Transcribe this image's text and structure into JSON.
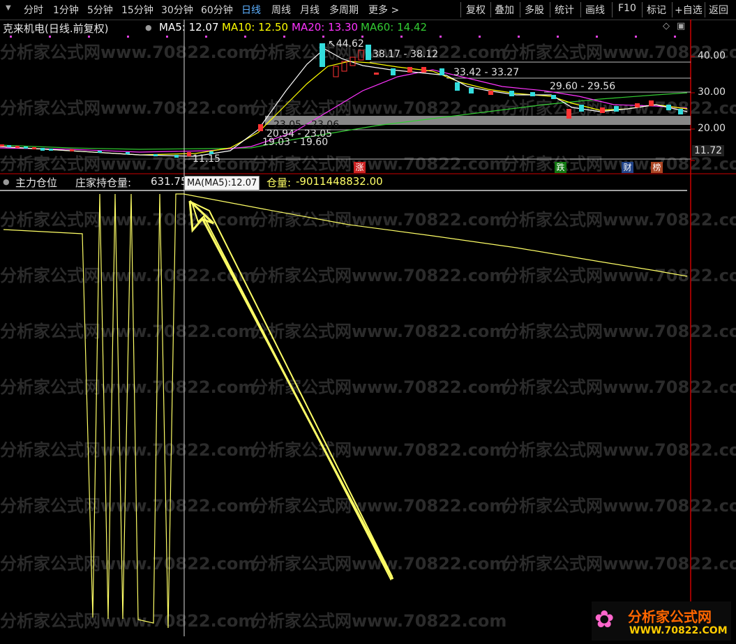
{
  "toolbar": {
    "periods": [
      "分时",
      "1分钟",
      "5分钟",
      "15分钟",
      "30分钟",
      "60分钟",
      "日线",
      "周线",
      "月线",
      "多周期",
      "更多 >"
    ],
    "active_period": "日线",
    "tools": [
      "复权",
      "叠加",
      "多股",
      "统计",
      "画线",
      "F10",
      "标记",
      "+自选",
      "返回"
    ]
  },
  "chart_title": {
    "stock_name": "克来机电(日线.前复权)",
    "ma5": "MA5: 12.07",
    "ma10": "MA10: 12.50",
    "ma20": "MA20: 13.30",
    "ma60": "MA60: 14.42"
  },
  "colors": {
    "ma5": "#ffffff",
    "ma10": "#ffff00",
    "ma20": "#ff33ff",
    "ma60": "#33cc33",
    "up": "#ff3333",
    "down": "#33dddd",
    "indicator": "#ffff66",
    "axis": "#cc0000"
  },
  "price_axis": {
    "labels": [
      "40.00",
      "30.00",
      "20.00",
      "11.72"
    ]
  },
  "annotations": {
    "high": "44.62",
    "level1": "38.17 - 38.12",
    "level2": "33.42 - 33.27",
    "level3": "29.60 - 29.56",
    "level4": "23.05 - 23.06",
    "level5": "20.94 - 23.05",
    "level6": "19.03 - 19.60",
    "low": "11.15"
  },
  "events": [
    "涨",
    "跌",
    "财",
    "榜"
  ],
  "indicator": {
    "name": "主力仓位",
    "label": "庄家持仓量:",
    "value": "631.75",
    "label2": "仓量:",
    "value2": "-9011448832.00",
    "tooltip": "MA(MA5):12.07"
  },
  "watermark": "分析家公式网www.70822.com",
  "logo": {
    "title": "分析家公式网",
    "url": "WWW.70822.COM"
  }
}
